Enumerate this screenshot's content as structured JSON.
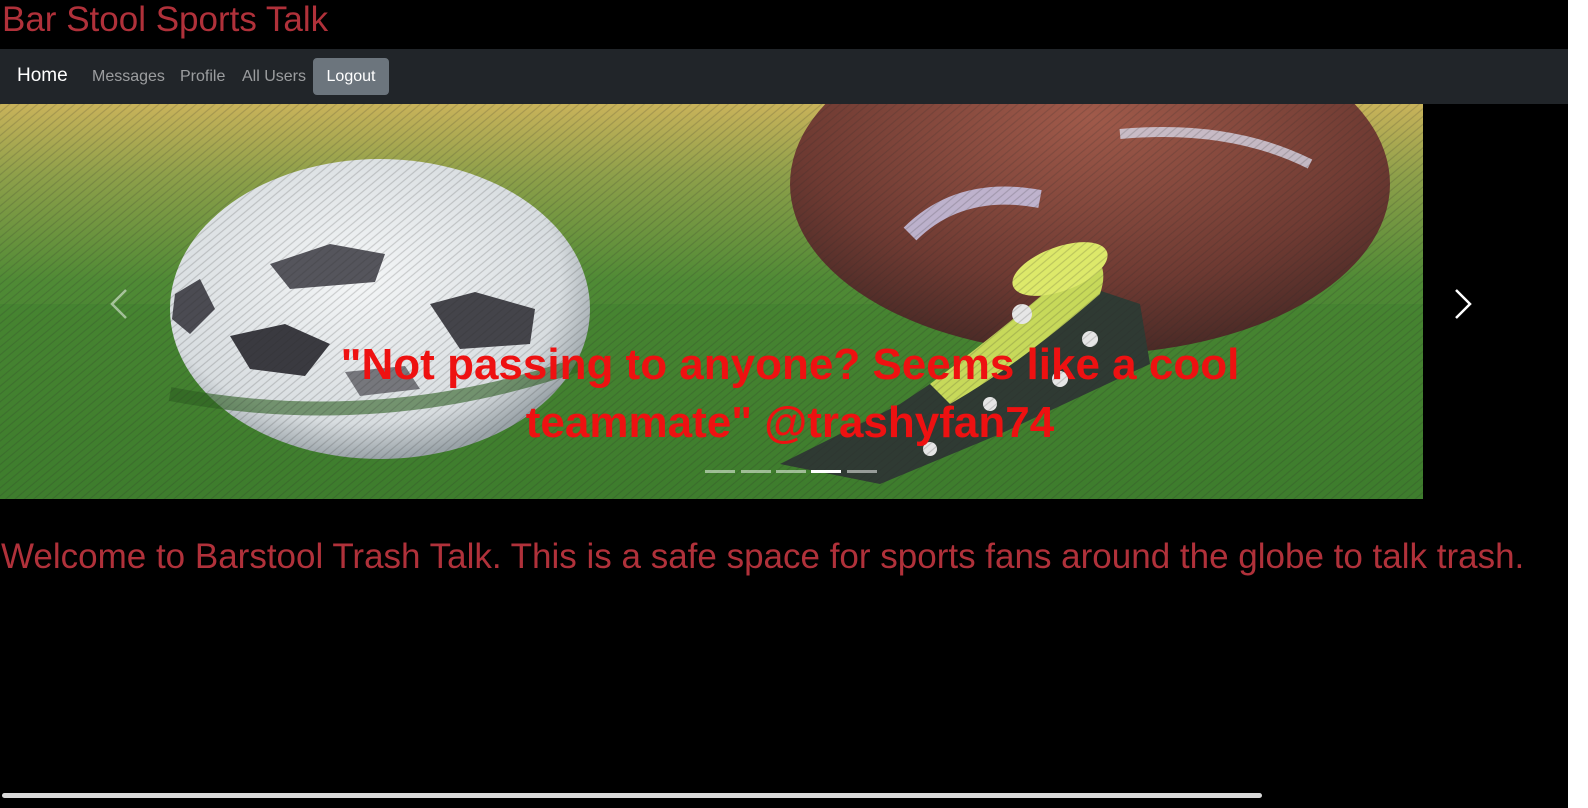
{
  "site": {
    "title": "Bar Stool Sports Talk"
  },
  "nav": {
    "brand": "Home",
    "links": [
      "Messages",
      "Profile",
      "All Users"
    ],
    "logout_label": "Logout"
  },
  "carousel": {
    "caption": "\"Not passing to anyone? Seems like a cool teammate\" @trashyfan74",
    "slide_count": 5,
    "active_index": 3,
    "image_description_icon": "soccer-football-image",
    "prev_icon": "chevron-left-icon",
    "next_icon": "chevron-right-icon"
  },
  "welcome": {
    "text": "Welcome to Barstool Trash Talk. This is a safe space for sports fans around the globe to talk trash."
  },
  "colors": {
    "accent": "#b0313a",
    "caption": "#ee1111",
    "navbar": "#212529",
    "button": "#6c757d"
  }
}
